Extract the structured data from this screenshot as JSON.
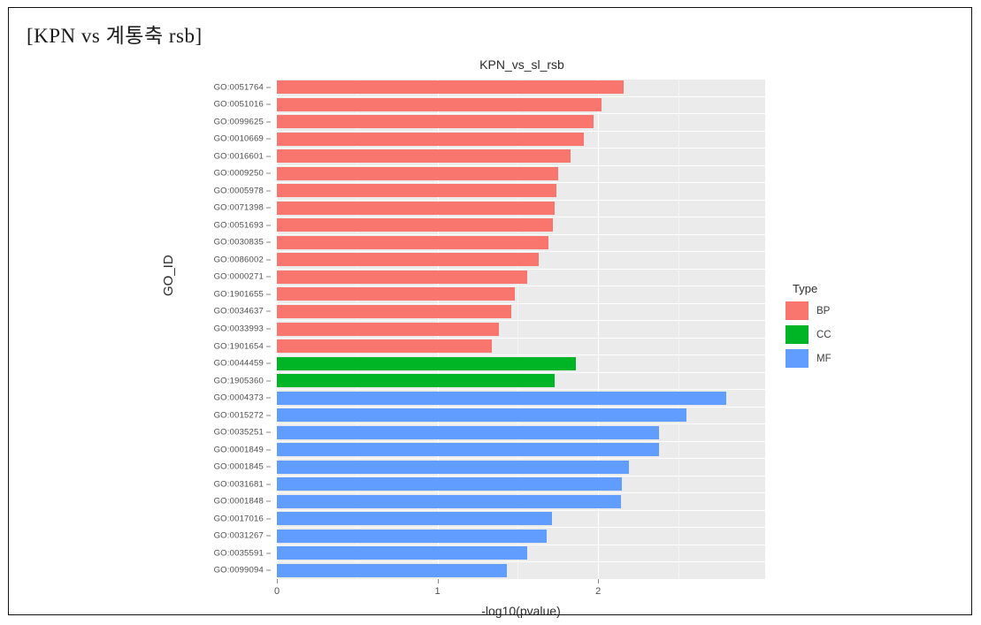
{
  "caption": "[KPN  vs  계통축  rsb]",
  "chart_data": {
    "type": "bar",
    "orientation": "horizontal",
    "title": "KPN_vs_sl_rsb",
    "xlabel": "-log10(pvalue)",
    "ylabel": "GO_ID",
    "xlim": [
      0,
      3.04
    ],
    "xticks": [
      0,
      1,
      2
    ],
    "xtick_labels": [
      "0",
      "1",
      "2"
    ],
    "grid": true,
    "legend": {
      "title": "Type",
      "position": "right",
      "entries": [
        {
          "label": "BP",
          "color": "#F8766D"
        },
        {
          "label": "CC",
          "color": "#00B525"
        },
        {
          "label": "MF",
          "color": "#619CFF"
        }
      ]
    },
    "categories": [
      "GO:0051764",
      "GO:0051016",
      "GO:0099625",
      "GO:0010669",
      "GO:0016601",
      "GO:0009250",
      "GO:0005978",
      "GO:0071398",
      "GO:0051693",
      "GO:0030835",
      "GO:0086002",
      "GO:0000271",
      "GO:1901655",
      "GO:0034637",
      "GO:0033993",
      "GO:1901654",
      "GO:0044459",
      "GO:1905360",
      "GO:0004373",
      "GO:0015272",
      "GO:0035251",
      "GO:0001849",
      "GO:0001845",
      "GO:0031681",
      "GO:0001848",
      "GO:0017016",
      "GO:0031267",
      "GO:0035591",
      "GO:0099094"
    ],
    "values": [
      2.16,
      2.02,
      1.97,
      1.91,
      1.83,
      1.75,
      1.74,
      1.73,
      1.72,
      1.69,
      1.63,
      1.56,
      1.48,
      1.46,
      1.38,
      1.34,
      1.86,
      1.73,
      2.8,
      2.55,
      2.38,
      2.38,
      2.19,
      2.15,
      2.14,
      1.71,
      1.68,
      1.56,
      1.43
    ],
    "types": [
      "BP",
      "BP",
      "BP",
      "BP",
      "BP",
      "BP",
      "BP",
      "BP",
      "BP",
      "BP",
      "BP",
      "BP",
      "BP",
      "BP",
      "BP",
      "BP",
      "CC",
      "CC",
      "MF",
      "MF",
      "MF",
      "MF",
      "MF",
      "MF",
      "MF",
      "MF",
      "MF",
      "MF",
      "MF"
    ]
  }
}
